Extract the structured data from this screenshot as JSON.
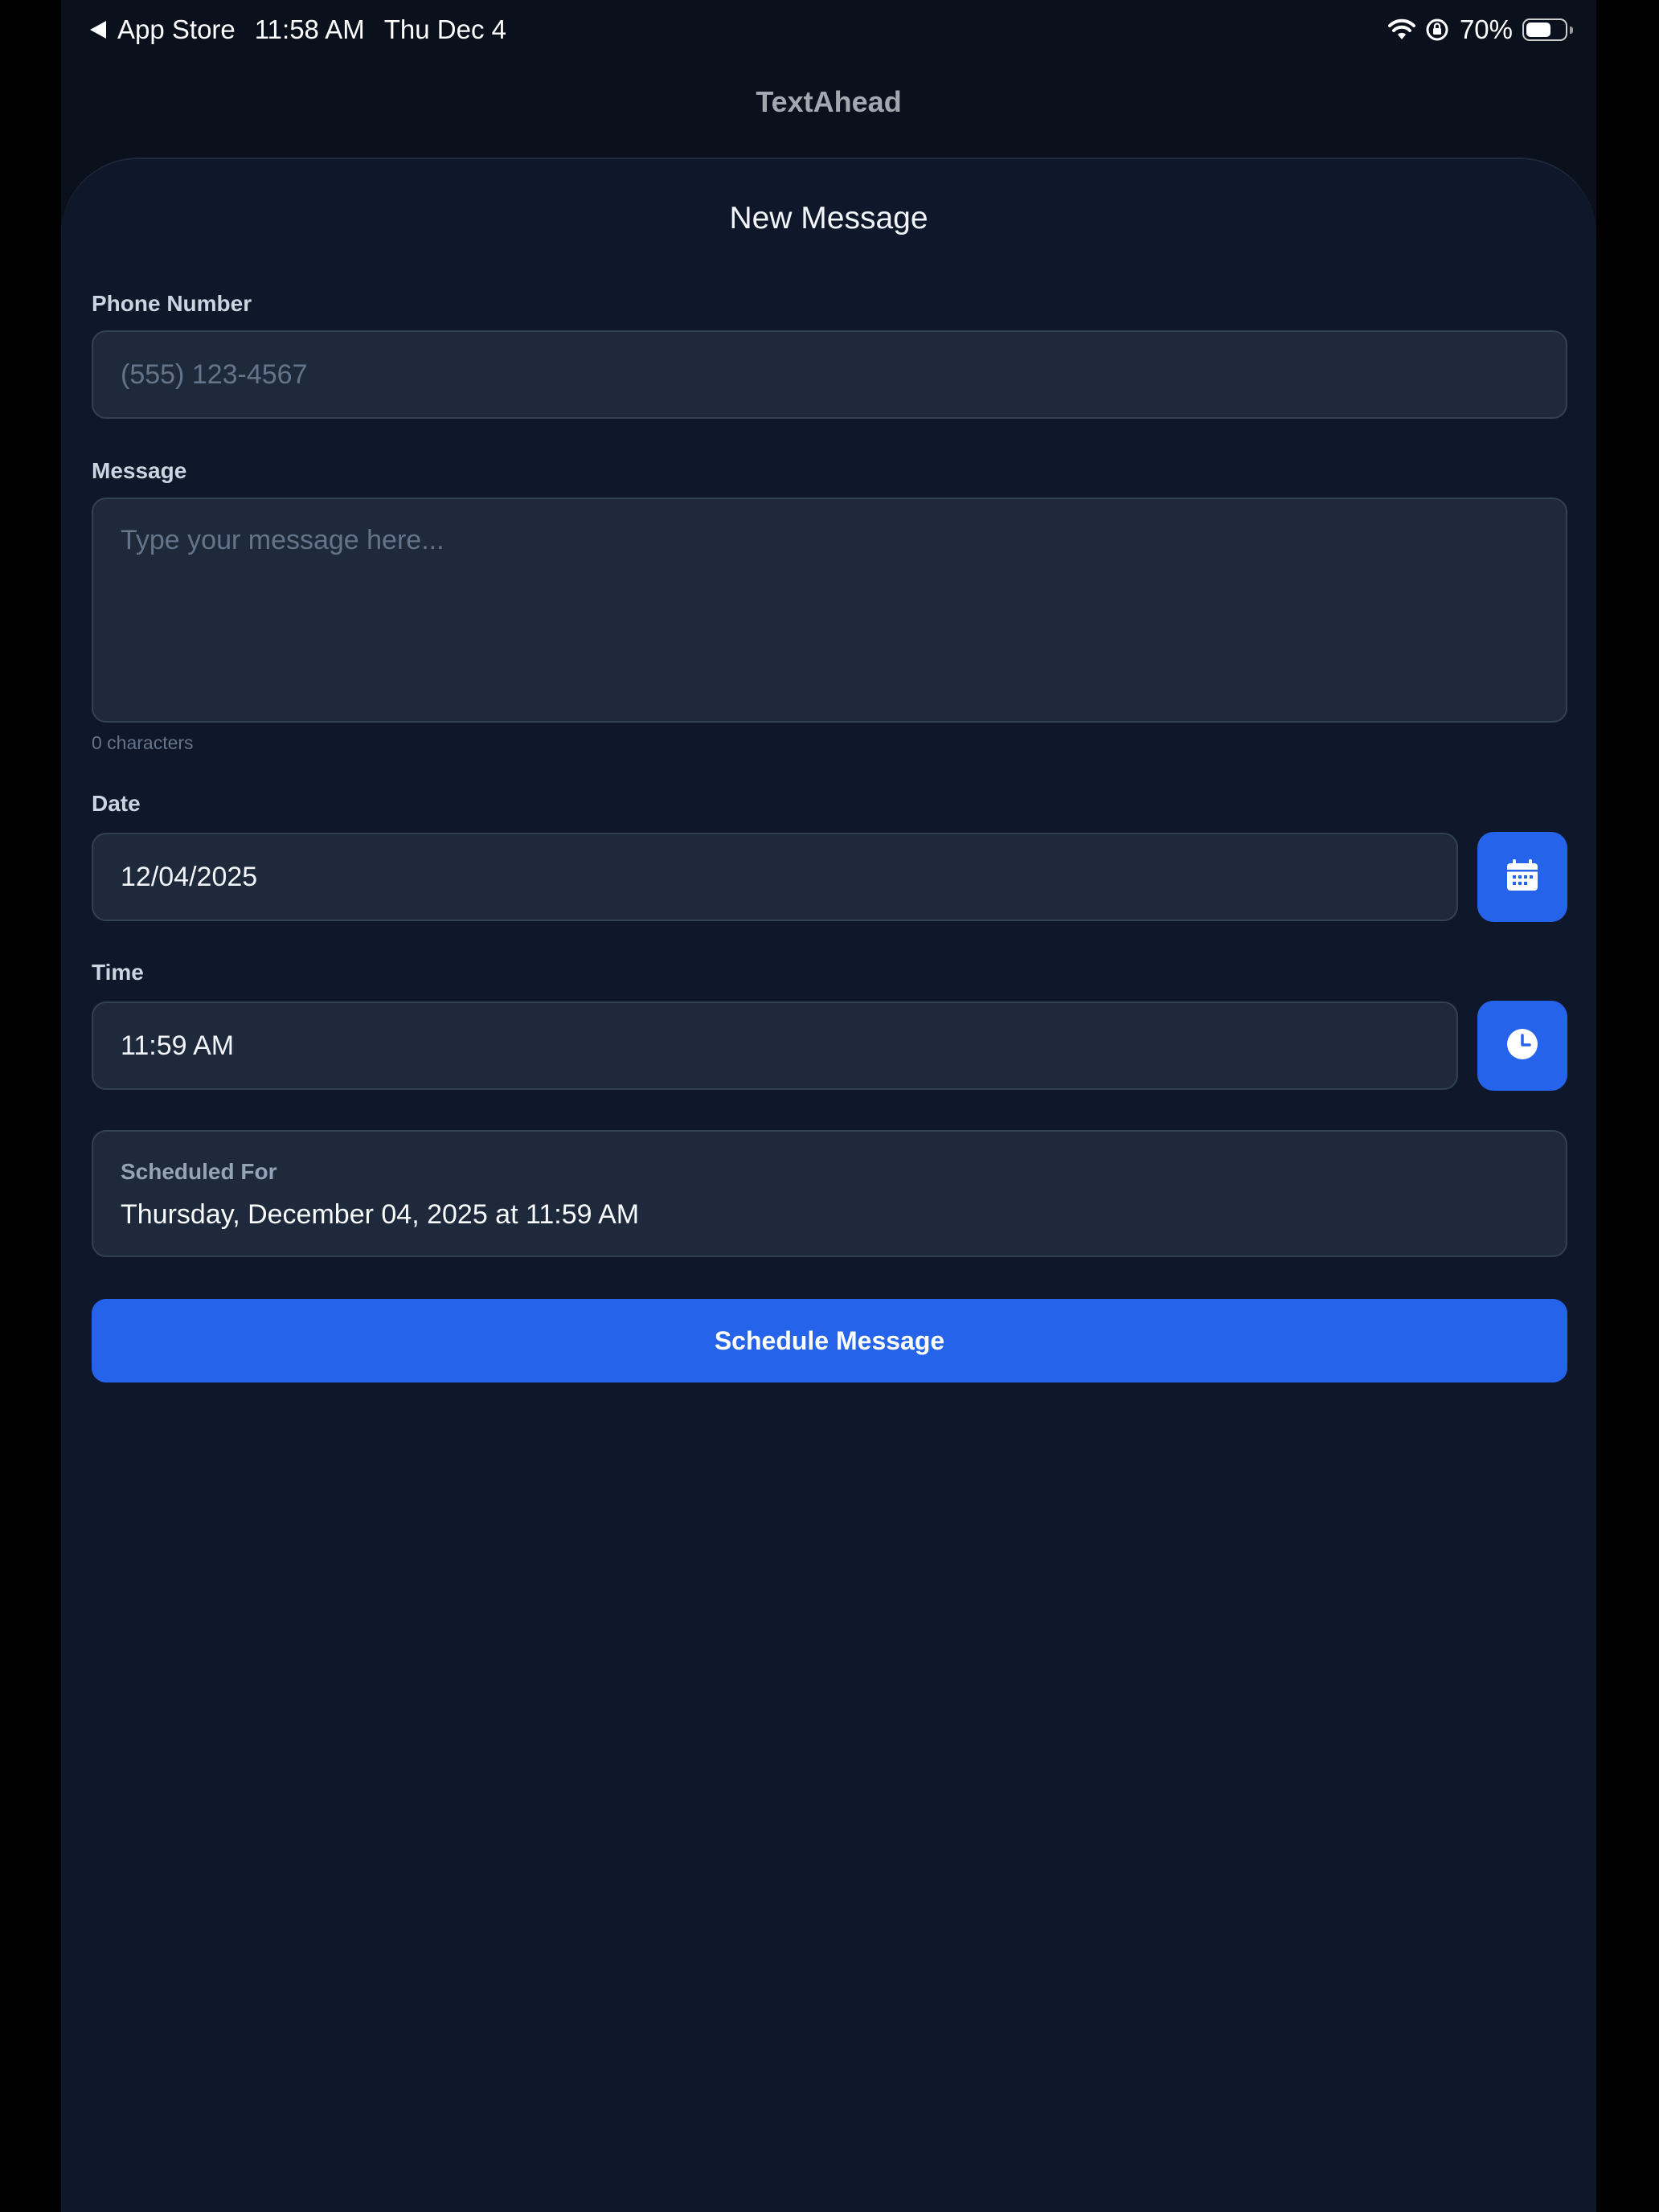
{
  "status_bar": {
    "back_app": "App Store",
    "time": "11:58 AM",
    "date": "Thu Dec 4",
    "battery_percent": "70%",
    "battery_level": 0.7
  },
  "nav": {
    "title": "TextAhead"
  },
  "sheet": {
    "title": "New Message",
    "phone": {
      "label": "Phone Number",
      "placeholder": "(555) 123-4567",
      "value": ""
    },
    "message": {
      "label": "Message",
      "placeholder": "Type your message here...",
      "value": "",
      "char_count": "0 characters"
    },
    "date": {
      "label": "Date",
      "value": "12/04/2025",
      "button_icon": "calendar-icon"
    },
    "time": {
      "label": "Time",
      "value": "11:59 AM",
      "button_icon": "clock-icon"
    },
    "summary": {
      "label": "Scheduled For",
      "value": "Thursday, December 04, 2025 at 11:59 AM"
    },
    "submit_label": "Schedule Message"
  },
  "colors": {
    "background": "#0f172a",
    "field_bg": "#1e293b",
    "accent": "#2563eb"
  }
}
